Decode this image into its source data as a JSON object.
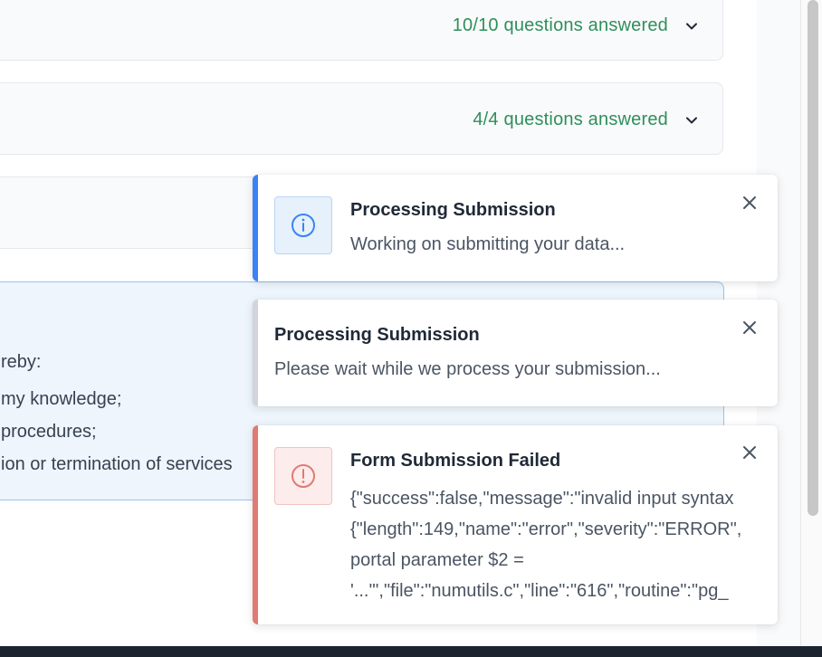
{
  "sections": [
    {
      "status": "10/10 questions answered"
    },
    {
      "status": "4/4 questions answered"
    }
  ],
  "declaration": {
    "lines": [
      "reby:",
      "my knowledge;",
      "procedures;",
      "ion or termination of services"
    ]
  },
  "toasts": [
    {
      "type": "info",
      "accent_color": "#3b82f6",
      "icon": "info-icon",
      "title": "Processing Submission",
      "message": "Working on submitting your data..."
    },
    {
      "type": "neutral",
      "accent_color": "#d1d5db",
      "title": "Processing Submission",
      "message": "Please wait while we process your submission..."
    },
    {
      "type": "error",
      "accent_color": "#e07a72",
      "icon": "error-icon",
      "title": "Form Submission Failed",
      "message_lines": [
        "{\"success\":false,\"message\":\"invalid input syntax",
        "{\"length\":149,\"name\":\"error\",\"severity\":\"ERROR\",",
        "portal parameter $2 =",
        "'...'\",\"file\":\"numutils.c\",\"line\":\"616\",\"routine\":\"pg_"
      ]
    }
  ],
  "colors": {
    "status_green": "#2f8f5b",
    "info_blue": "#3b82f6",
    "error_red": "#e07a72"
  }
}
